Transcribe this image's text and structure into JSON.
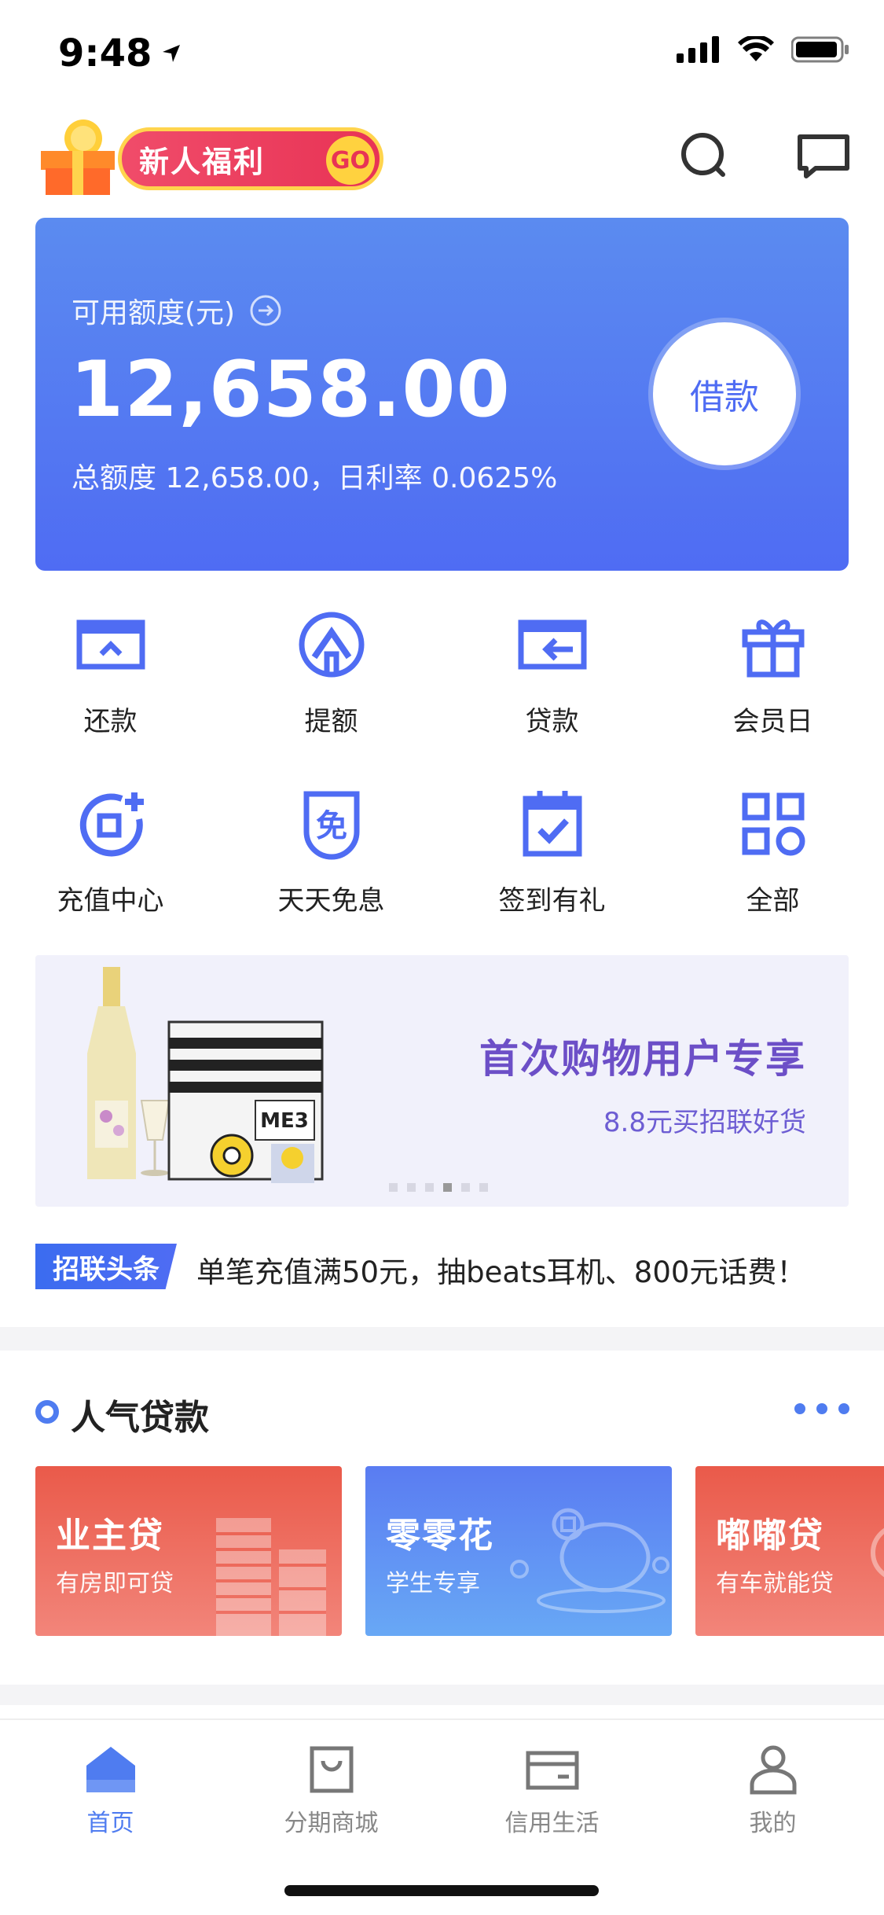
{
  "status_bar": {
    "time": "9:48"
  },
  "top_bar": {
    "promo_label": "新人福利",
    "promo_go": "GO",
    "search_icon": "search-icon",
    "message_icon": "message-icon"
  },
  "credit": {
    "label": "可用额度(元)",
    "amount": "12,658.00",
    "summary": "总额度 12,658.00，日利率 0.0625%",
    "borrow_button": "借款"
  },
  "quick_actions": [
    {
      "label": "还款",
      "icon": "repay-icon"
    },
    {
      "label": "提额",
      "icon": "raise-limit-icon"
    },
    {
      "label": "贷款",
      "icon": "loan-icon"
    },
    {
      "label": "会员日",
      "icon": "gift-icon"
    },
    {
      "label": "充值中心",
      "icon": "recharge-icon"
    },
    {
      "label": "天天免息",
      "icon": "interest-free-icon"
    },
    {
      "label": "签到有礼",
      "icon": "calendar-check-icon"
    },
    {
      "label": "全部",
      "icon": "all-apps-icon"
    }
  ],
  "banner": {
    "title": "首次购物用户专享",
    "subtitle": "8.8元买招联好货",
    "product_text": "ME3",
    "page_count": 6,
    "active_page": 4
  },
  "news": {
    "tag": "招联头条",
    "text": "单笔充值满50元，抽beats耳机、800元话费！"
  },
  "popular_loans": {
    "title": "人气贷款",
    "items": [
      {
        "name": "业主贷",
        "desc": "有房即可贷"
      },
      {
        "name": "零零花",
        "desc": "学生专享"
      },
      {
        "name": "嘟嘟贷",
        "desc": "有车就能贷"
      }
    ]
  },
  "tab_bar": [
    {
      "label": "首页",
      "icon": "home-icon",
      "active": true
    },
    {
      "label": "分期商城",
      "icon": "shopping-bag-icon",
      "active": false
    },
    {
      "label": "信用生活",
      "icon": "card-icon",
      "active": false
    },
    {
      "label": "我的",
      "icon": "profile-icon",
      "active": false
    }
  ],
  "colors": {
    "accent": "#4f7cf0",
    "card_blue": "#4f6cf3",
    "loan_red": "#ea5a4a",
    "banner_purple": "#6c4fc7"
  }
}
